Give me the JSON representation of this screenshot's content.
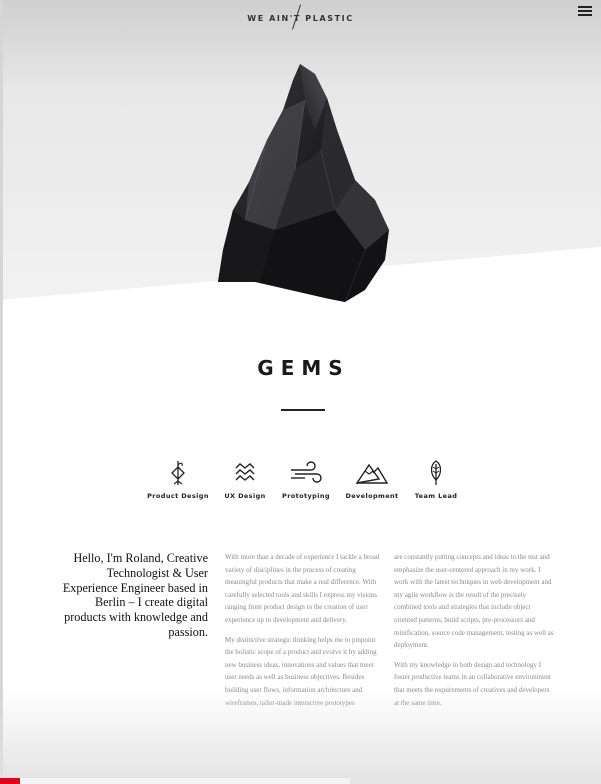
{
  "header": {
    "logo_text": "WE AIN'T PLASTIC",
    "menu_icon": "hamburger-menu-icon"
  },
  "hero": {
    "image": "black-gem-rock"
  },
  "section": {
    "title": "GEMS"
  },
  "skills": [
    {
      "label": "Product Design",
      "icon": "diamond-sprout-icon"
    },
    {
      "label": "UX Design",
      "icon": "waves-icon"
    },
    {
      "label": "Prototyping",
      "icon": "wind-icon"
    },
    {
      "label": "Development",
      "icon": "mountains-icon"
    },
    {
      "label": "Team Lead",
      "icon": "feather-icon"
    }
  ],
  "about": {
    "intro": "Hello, I'm Roland, Creative Technologist & User Experience Engineer based in Berlin – I create digital products with knowledge and passion.",
    "col1_p1": "With more than a decade of experience I tackle a broad variety of disciplines in the process of creating meaningful products that make a real difference. With carefully selected tools and skills I express my visions ranging from product design to the creation of user experience up to development and delivery.",
    "col1_p2": "My distinctive strategic thinking helps me to pinpoint the holistic scope of a product and evolve it by adding new business ideas, innovations and values that meet user needs as well as business objectives. Besides building user flows, information architecture and wireframes, tailor-made interactive prototypes",
    "col2_p1": "are constantly putting concepts and ideas to the test and emphasize the user-centered approach in my work. I work with the latest techniques in web development and my agile workflow is the result of the precisely combined tools and strategies that include object oriented patterns, build scripts, pre-processors and minification, source code management, testing as well as deployment.",
    "col2_p2": "With my knowledge in both design and technology I foster productive teams in an collaborative environment that meets the requirements of creatives and developers at the same time."
  },
  "progress": {
    "fraction": 0.034,
    "accent_color": "#e0001b"
  }
}
